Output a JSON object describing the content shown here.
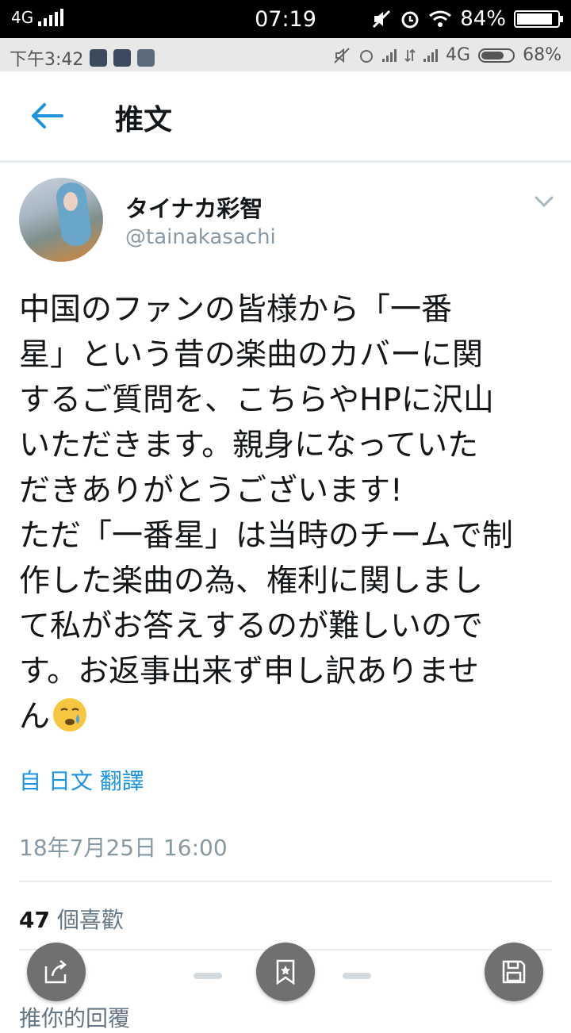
{
  "system_bar": {
    "network": "4G",
    "time": "07:19",
    "battery": "84%",
    "battery_level": 0.84
  },
  "inner_bar": {
    "time": "下午3:42",
    "network": "4G",
    "battery": "68%",
    "battery_level": 0.68
  },
  "header": {
    "title": "推文",
    "back_icon": "arrow-left-icon"
  },
  "tweet": {
    "display_name": "タイナカ彩智",
    "handle": "@tainakasachi",
    "text": "中国のファンの皆様から「一番\n星」という昔の楽曲のカバーに関\nするご質問を、こちらやHPに沢山\nいただきます。親身になっていた\nだきありがとうございます!\nただ「一番星」は当時のチームで制\n作した楽曲の為、権利に関しまし\nて私がお答えするのが難しいので\nす。お返事出来ず申し訳ありませ\nん",
    "emoji": "crying-face",
    "translate_label": "自 日文 翻譯",
    "timestamp": "18年7月25日 16:00",
    "likes_count": "47",
    "likes_label": "個喜歡",
    "replies_partial": "推你的回覆"
  },
  "colors": {
    "accent": "#1b95e0",
    "muted": "#8899a6",
    "fab": "#6f7072"
  },
  "fabs": [
    "share-icon",
    "star-bookmark-icon",
    "save-icon"
  ]
}
